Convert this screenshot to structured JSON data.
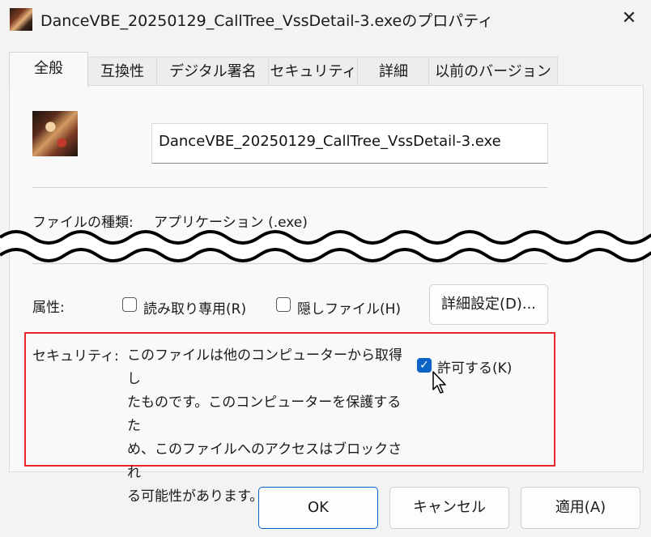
{
  "window": {
    "title": "DanceVBE_20250129_CallTree_VssDetail-3.exeのプロパティ",
    "close_glyph": "✕"
  },
  "tabs": [
    {
      "label": "全般"
    },
    {
      "label": "互換性"
    },
    {
      "label": "デジタル署名"
    },
    {
      "label": "セキュリティ"
    },
    {
      "label": "詳細"
    },
    {
      "label": "以前のバージョン"
    }
  ],
  "general": {
    "file_name": "DanceVBE_20250129_CallTree_VssDetail-3.exe",
    "file_type_label": "ファイルの種類:",
    "file_type_value": "アプリケーション (.exe)",
    "attributes_label": "属性:",
    "readonly_label": "読み取り専用(R)",
    "readonly_checked": false,
    "hidden_label": "隠しファイル(H)",
    "hidden_checked": false,
    "advanced_button": "詳細設定(D)...",
    "security_label": "セキュリティ:",
    "security_text": "このファイルは他のコンピューターから取得したものです。このコンピューターを保護するため、このファイルへのアクセスはブロックされる可能性があります。",
    "security_lines": [
      "このファイルは他のコンピューターから取得し",
      "たものです。このコンピューターを保護するた",
      "め、このファイルへのアクセスはブロックされ",
      "る可能性があります。"
    ],
    "unblock_label": "許可する(K)",
    "unblock_checked": true
  },
  "footer": {
    "ok": "OK",
    "cancel": "キャンセル",
    "apply": "適用(A)"
  },
  "colors": {
    "highlight_border": "#e8262d",
    "accent": "#0a64c8"
  },
  "icons": {
    "app_icon": "app-icon",
    "file_icon": "file-icon",
    "checkmark": "✓",
    "cursor": "mouse-cursor-icon"
  }
}
